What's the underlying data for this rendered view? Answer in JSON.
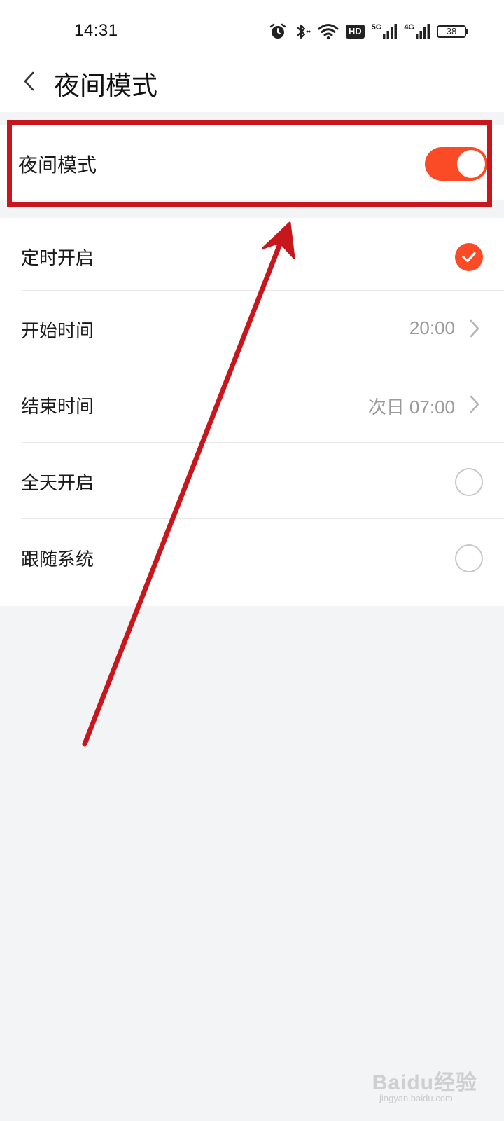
{
  "status_bar": {
    "time": "14:31",
    "battery_level": "38",
    "hd_label": "HD",
    "net_5g": "5G",
    "net_4g": "4G",
    "icons": [
      "alarm-icon",
      "bluetooth-icon",
      "wifi-icon",
      "hd-icon",
      "signal-5g-icon",
      "signal-4g-icon",
      "battery-icon"
    ]
  },
  "header": {
    "title": "夜间模式"
  },
  "night_mode": {
    "label": "夜间模式",
    "enabled": true
  },
  "list": {
    "scheduled": {
      "label": "定时开启",
      "selected": true
    },
    "start_time": {
      "label": "开始时间",
      "value": "20:00"
    },
    "end_time": {
      "label": "结束时间",
      "value": "次日 07:00"
    },
    "all_day": {
      "label": "全天开启",
      "selected": false
    },
    "follow_system": {
      "label": "跟随系统",
      "selected": false
    }
  },
  "watermark": {
    "brand": "Baidu经验",
    "url": "jingyan.baidu.com"
  },
  "colors": {
    "accent": "#fa4b26",
    "annotation": "#c8161d",
    "background": "#f2f4f5",
    "secondary_text": "#9a9a9a"
  }
}
